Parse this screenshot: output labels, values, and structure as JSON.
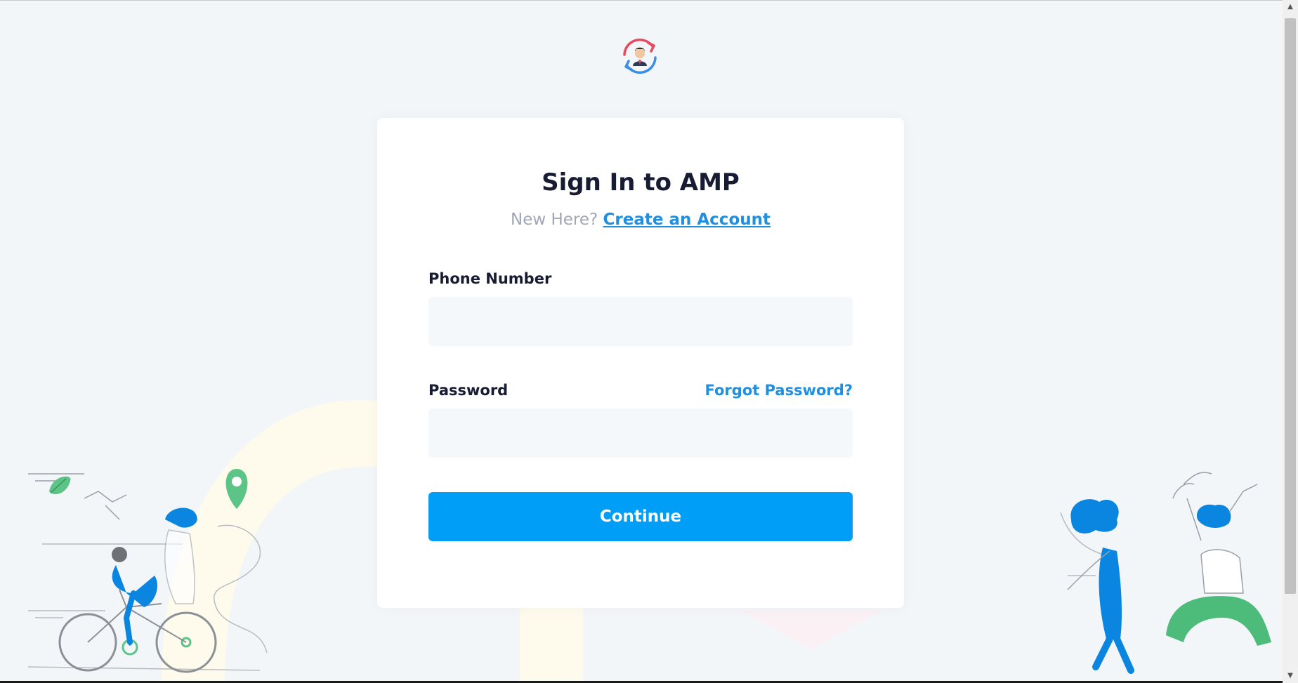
{
  "colors": {
    "background": "#f3f6f9",
    "card": "#ffffff",
    "title": "#181c32",
    "muted": "#a1a5b7",
    "link": "#1e8fe1",
    "primary": "#009ef7",
    "input_bg": "#f5f8fa"
  },
  "logo": {
    "icon": "user-sync-icon"
  },
  "signin": {
    "title": "Sign In to AMP",
    "new_here": "New Here?",
    "create_account": "Create an Account"
  },
  "form": {
    "phone_label": "Phone Number",
    "phone_value": "",
    "phone_placeholder": "",
    "password_label": "Password",
    "password_value": "",
    "password_placeholder": "",
    "forgot": "Forgot Password?",
    "continue": "Continue"
  },
  "illustrations": {
    "left": "cyclist-and-map-pin-illustration",
    "right": "jumping-people-illustration"
  }
}
